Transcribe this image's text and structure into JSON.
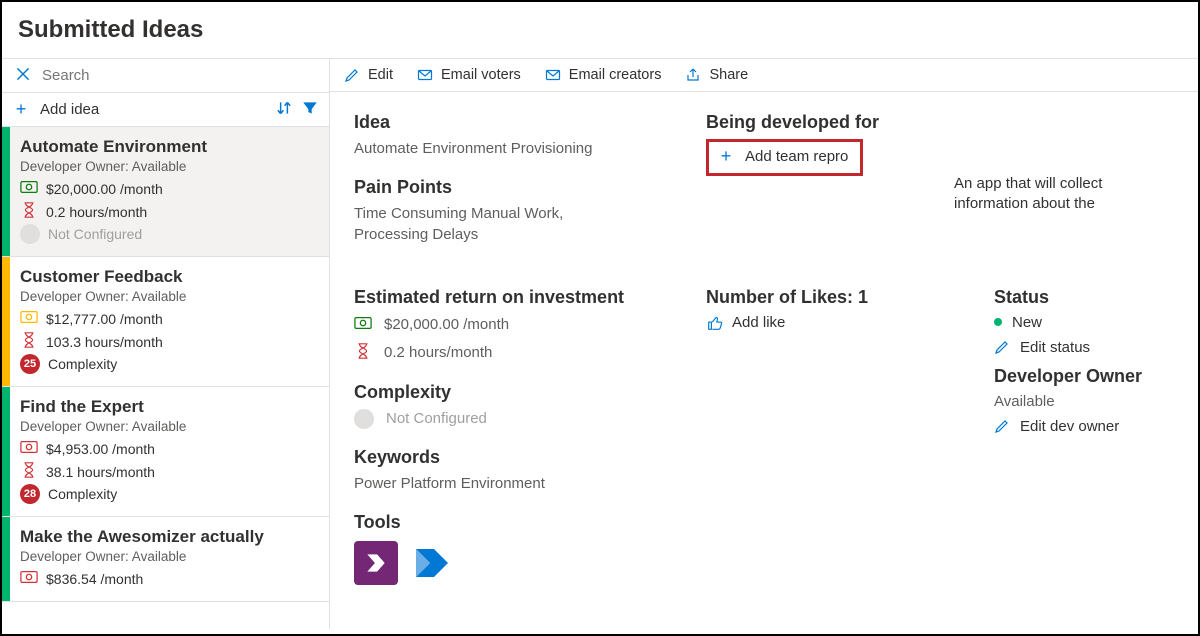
{
  "page_title": "Submitted Ideas",
  "search": {
    "placeholder": "Search"
  },
  "add_idea_label": "Add idea",
  "toolbar": {
    "edit": "Edit",
    "email_voters": "Email voters",
    "email_creators": "Email creators",
    "share": "Share"
  },
  "colors": {
    "blue": "#0078d4",
    "green_stripe": "#00b46e",
    "yellow_stripe": "#ffb900",
    "money_green": "#107c10",
    "money_yellow": "#ffb900",
    "money_red": "#d13438",
    "badge_red": "#c1272d",
    "status_new": "#00b46e"
  },
  "ideas": [
    {
      "stripe": "#00b46e",
      "title": "Automate Environment",
      "owner": "Developer Owner: Available",
      "money": "$20,000.00 /month",
      "money_color": "#107c10",
      "hours": "0.2 hours/month",
      "complexity_label": "Not Configured",
      "complexity_badge": null,
      "muted_complexity": true,
      "selected": true
    },
    {
      "stripe": "#ffb900",
      "title": "Customer Feedback",
      "owner": "Developer Owner: Available",
      "money": "$12,777.00 /month",
      "money_color": "#ffb900",
      "hours": "103.3 hours/month",
      "complexity_label": "Complexity",
      "complexity_badge": "25",
      "muted_complexity": false,
      "selected": false
    },
    {
      "stripe": "#00b46e",
      "title": "Find the Expert",
      "owner": "Developer Owner: Available",
      "money": "$4,953.00 /month",
      "money_color": "#d13438",
      "hours": "38.1 hours/month",
      "complexity_label": "Complexity",
      "complexity_badge": "28",
      "muted_complexity": false,
      "selected": false
    },
    {
      "stripe": "#00b46e",
      "title": "Make the Awesomizer actually",
      "owner": "Developer Owner: Available",
      "money": "$836.54 /month",
      "money_color": "#d13438",
      "hours": "",
      "complexity_label": "",
      "complexity_badge": null,
      "muted_complexity": false,
      "selected": false
    }
  ],
  "detail": {
    "idea_heading": "Idea",
    "idea_name": "Automate Environment Provisioning",
    "pain_heading": "Pain Points",
    "pain_text": "Time Consuming Manual Work, Processing Delays",
    "roi_heading": "Estimated return on investment",
    "roi_money": "$20,000.00 /month",
    "roi_hours": "0.2 hours/month",
    "complexity_heading": "Complexity",
    "complexity_value": "Not Configured",
    "keywords_heading": "Keywords",
    "keywords_value": "Power Platform Environment",
    "tools_heading": "Tools",
    "being_dev_heading": "Being developed for",
    "add_team_label": "Add team repro",
    "likes_heading": "Number of Likes: 1",
    "add_like_label": "Add like",
    "status_heading": "Status",
    "status_value": "New",
    "edit_status_label": "Edit status",
    "dev_owner_heading": "Developer Owner",
    "dev_owner_value": "Available",
    "edit_dev_owner_label": "Edit dev owner",
    "description_float": "An app that will collect information about the"
  }
}
